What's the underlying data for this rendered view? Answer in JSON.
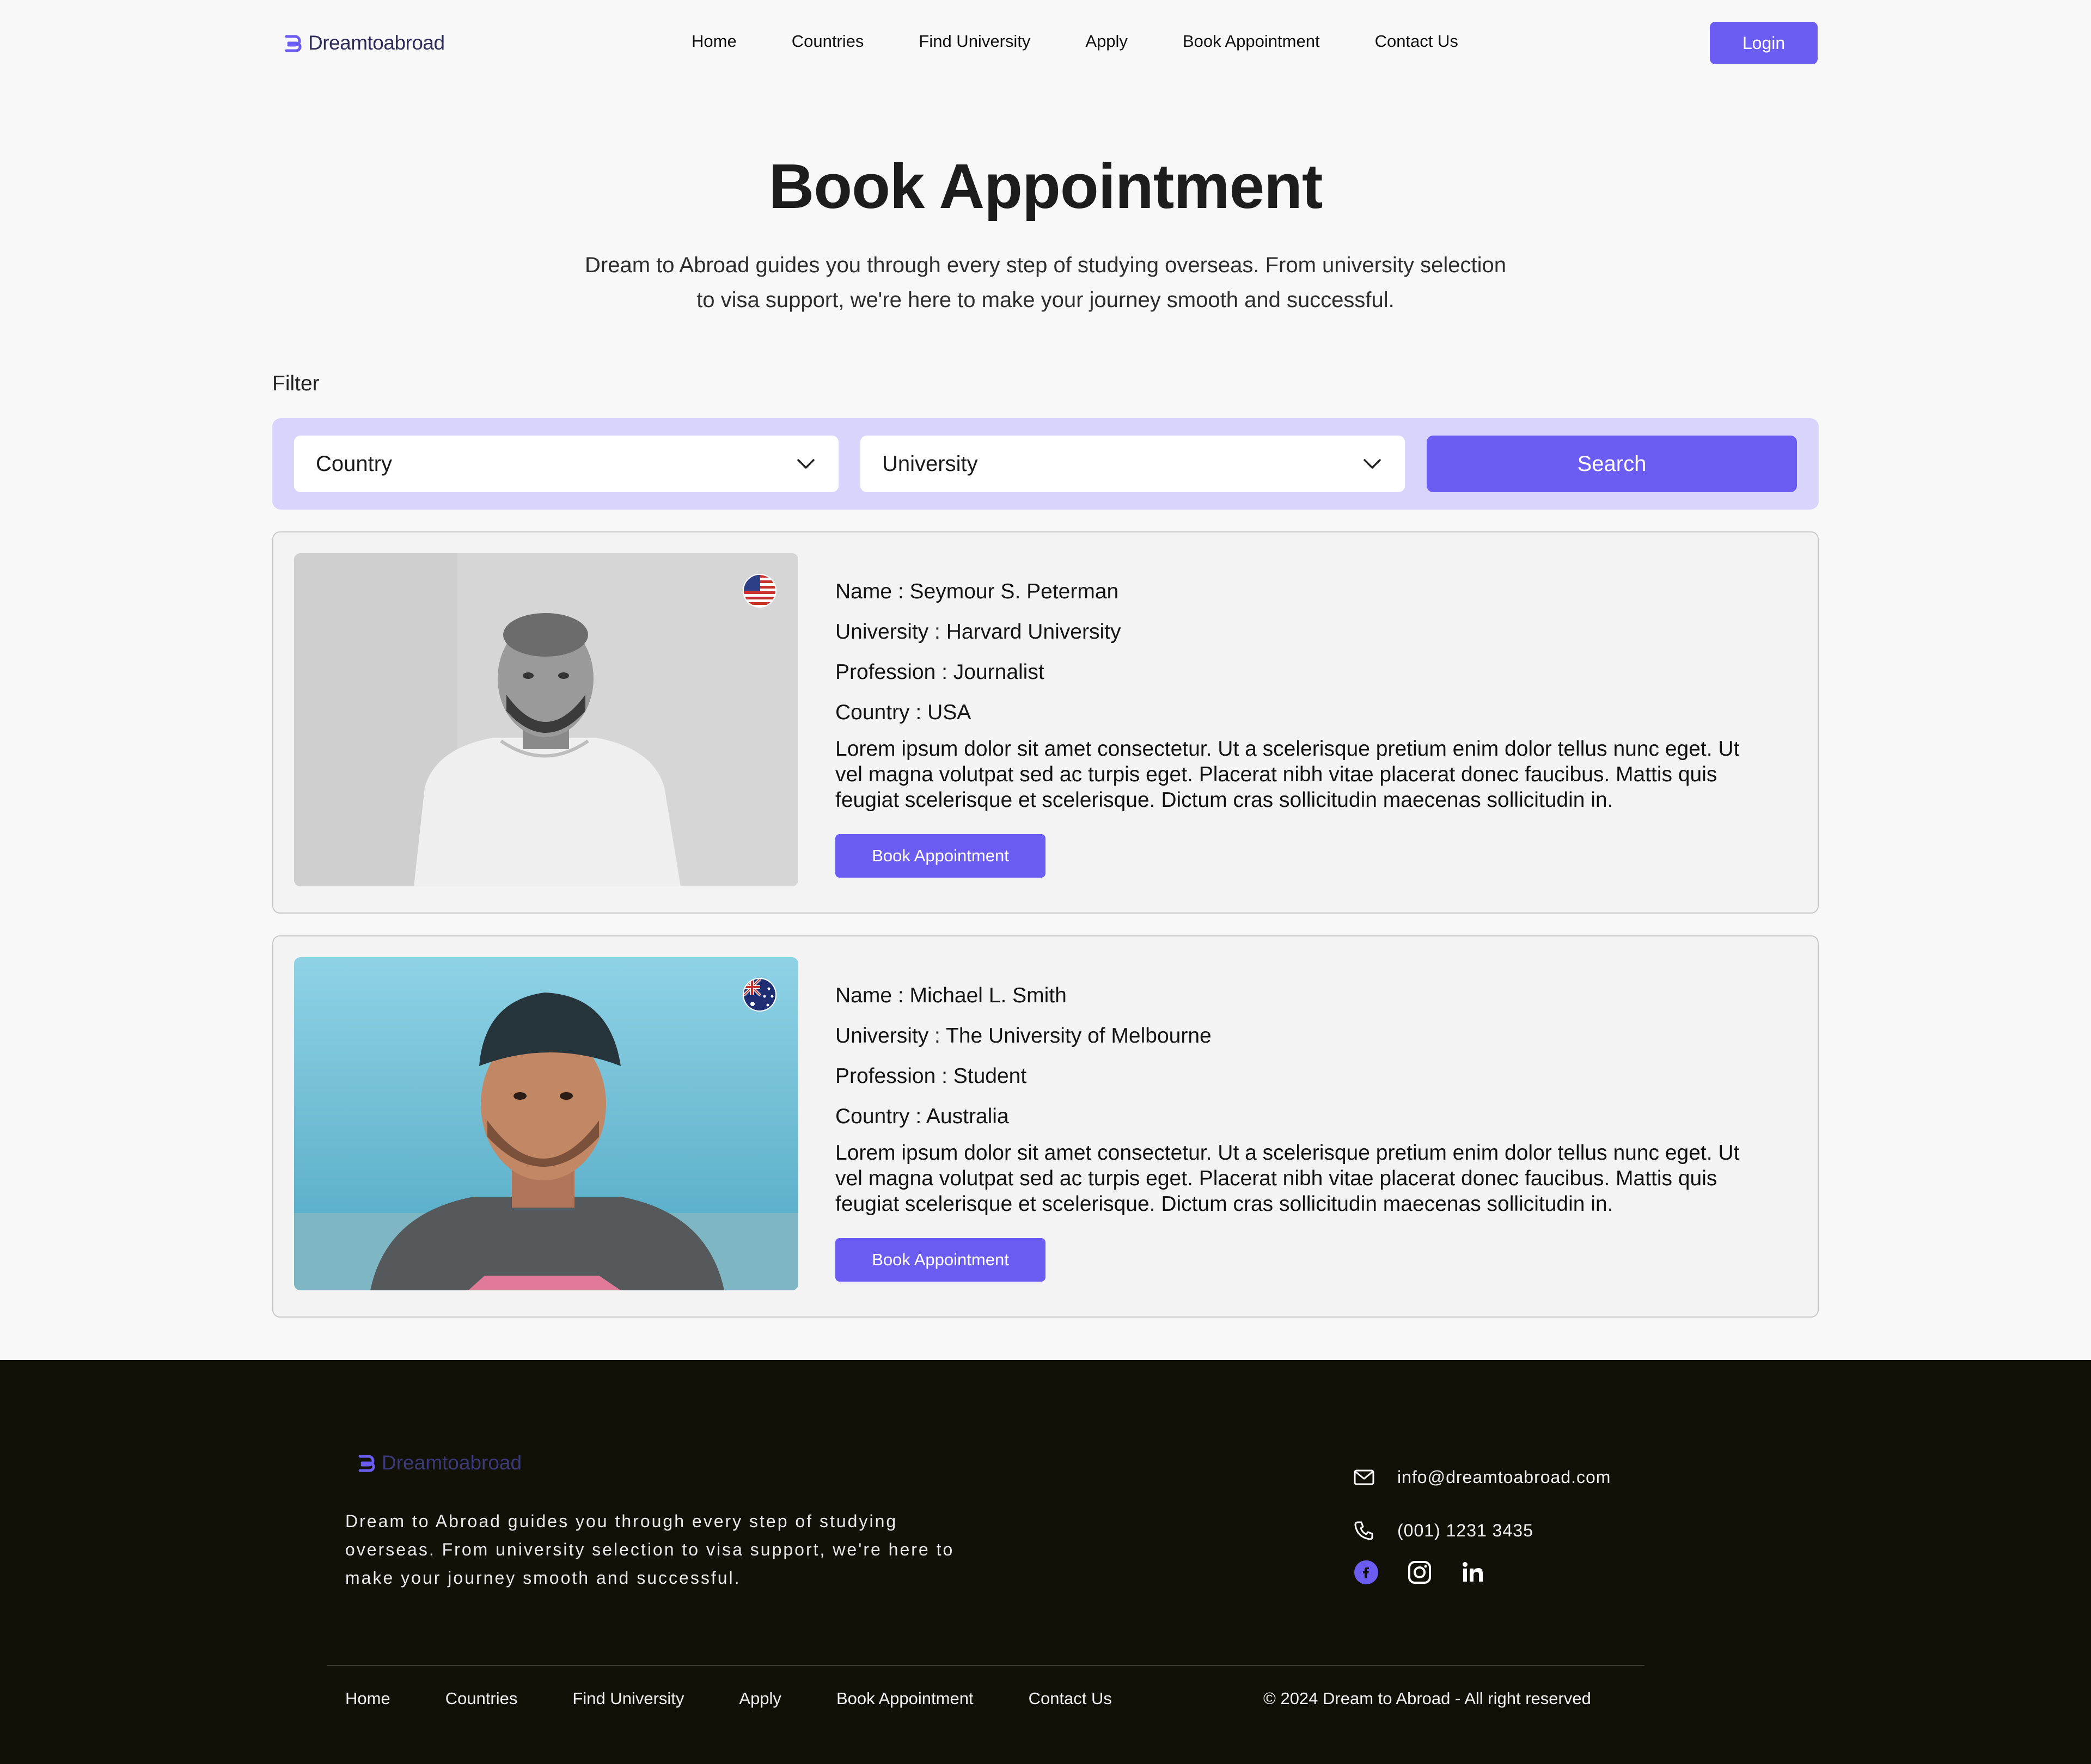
{
  "header": {
    "logo_text": "Dreamtoabroad",
    "nav": [
      "Home",
      "Countries",
      "Find University",
      "Apply",
      "Book Appointment",
      "Contact Us"
    ],
    "login_label": "Login"
  },
  "hero": {
    "title": "Book Appointment",
    "subtitle": "Dream to Abroad guides you through every step of studying overseas. From university selection to visa support, we're here to make your journey smooth and successful."
  },
  "filter": {
    "label": "Filter",
    "country_value": "Country",
    "university_value": "University",
    "search_label": "Search"
  },
  "cards": [
    {
      "name": "Name : Seymour S. Peterman",
      "university": "University : Harvard University",
      "profession": "Profession : Journalist",
      "country": "Country : USA",
      "description": "Lorem ipsum dolor sit amet consectetur. Ut a scelerisque pretium enim dolor tellus nunc eget. Ut vel magna volutpat sed ac turpis eget. Placerat nibh vitae placerat donec faucibus. Mattis quis feugiat scelerisque et scelerisque. Dictum cras sollicitudin maecenas sollicitudin in.",
      "button": "Book Appointment",
      "flag": "usa-flag-icon"
    },
    {
      "name": "Name : Michael L. Smith",
      "university": "University : The University of Melbourne",
      "profession": "Profession : Student",
      "country": "Country : Australia",
      "description": "Lorem ipsum dolor sit amet consectetur. Ut a scelerisque pretium enim dolor tellus nunc eget. Ut vel magna volutpat sed ac turpis eget. Placerat nibh vitae placerat donec faucibus. Mattis quis feugiat scelerisque et scelerisque. Dictum cras sollicitudin maecenas sollicitudin in.",
      "button": "Book Appointment",
      "flag": "australia-flag-icon"
    }
  ],
  "footer": {
    "logo_text": "Dreamtoabroad",
    "about": "Dream to Abroad guides you through every step of studying overseas. From university selection to visa support, we're here to make your journey smooth and successful.",
    "email": "info@dreamtoabroad.com",
    "phone": "(001) 1231 3435",
    "nav": [
      "Home",
      "Countries",
      "Find University",
      "Apply",
      "Book Appointment",
      "Contact Us"
    ],
    "copyright": "© 2024 Dream to Abroad - All right reserved"
  },
  "colors": {
    "accent": "#6b5cf2",
    "filter_bg": "#d8d4fb",
    "footer_bg": "#111108"
  }
}
